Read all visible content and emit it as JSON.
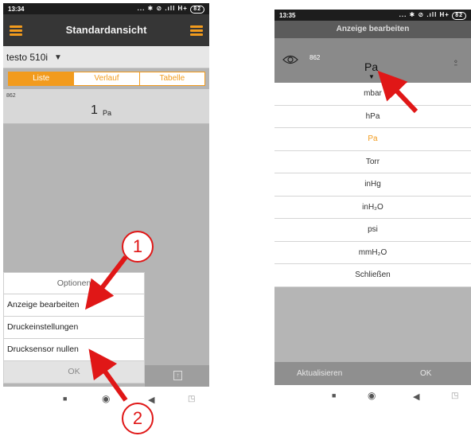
{
  "left_phone": {
    "status": {
      "time": "13:34",
      "icons": "... ✱ ⊘ .ıll H+",
      "battery": "82"
    },
    "title": "Standardansicht",
    "device": "testo 510i",
    "tabs": [
      {
        "label": "Liste",
        "active": true
      },
      {
        "label": "Verlauf",
        "active": false
      },
      {
        "label": "Tabelle",
        "active": false
      }
    ],
    "sensor_id": "862",
    "reading": {
      "value": "1",
      "unit": "Pa"
    },
    "options": {
      "header": "Optionen",
      "items": [
        "Anzeige bearbeiten",
        "Druckeinstellungen",
        "Drucksensor nullen"
      ],
      "ok": "OK"
    }
  },
  "right_phone": {
    "status": {
      "time": "13:35",
      "icons": "... ✱ ⊘ .ıll H+",
      "battery": "82"
    },
    "title": "Anzeige bearbeiten",
    "sensor_id": "862",
    "current_unit": "Pa",
    "units": [
      "mbar",
      "hPa",
      "Pa",
      "Torr",
      "inHg",
      "inH₂O",
      "psi",
      "mmH₂O",
      "Schließen"
    ],
    "selected_unit": "Pa",
    "bottom": {
      "refresh": "Aktualisieren",
      "ok": "OK"
    }
  },
  "annotations": [
    "1",
    "2"
  ],
  "colors": {
    "accent": "#f29b1d",
    "annotation": "#e01717",
    "titlebar": "#363636"
  }
}
